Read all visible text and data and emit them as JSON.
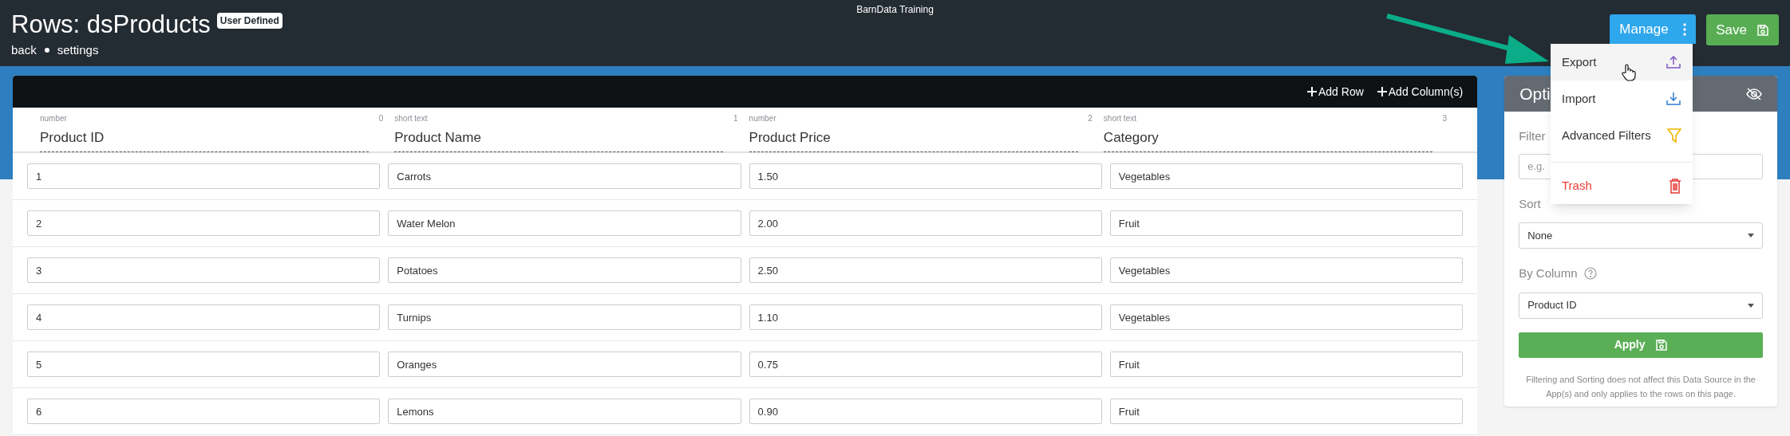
{
  "app_title": "BarnData Training",
  "page": {
    "title": "Rows: dsProducts",
    "badge": "User Defined",
    "links": [
      "back",
      "settings"
    ]
  },
  "actions": {
    "manage": "Manage",
    "save": "Save"
  },
  "manage_menu": [
    {
      "label": "Export",
      "kind": "export",
      "hovered": true
    },
    {
      "label": "Import",
      "kind": "import",
      "hovered": false
    },
    {
      "label": "Advanced Filters",
      "kind": "filter",
      "hovered": false
    },
    {
      "label": "Trash",
      "kind": "trash",
      "hovered": false
    }
  ],
  "table": {
    "toolbar": [
      "Add Row",
      "Add Column(s)"
    ],
    "columns": [
      {
        "type": "number",
        "index": "0",
        "name": "Product ID"
      },
      {
        "type": "short text",
        "index": "1",
        "name": "Product Name"
      },
      {
        "type": "number",
        "index": "2",
        "name": "Product Price"
      },
      {
        "type": "short text",
        "index": "3",
        "name": "Category"
      }
    ],
    "rows": [
      [
        "1",
        "Carrots",
        "1.50",
        "Vegetables"
      ],
      [
        "2",
        "Water Melon",
        "2.00",
        "Fruit"
      ],
      [
        "3",
        "Potatoes",
        "2.50",
        "Vegetables"
      ],
      [
        "4",
        "Turnips",
        "1.10",
        "Vegetables"
      ],
      [
        "5",
        "Oranges",
        "0.75",
        "Fruit"
      ],
      [
        "6",
        "Lemons",
        "0.90",
        "Fruit"
      ]
    ]
  },
  "options": {
    "title": "Opti",
    "filter_label": "Filter",
    "filter_placeholder": "e.g.",
    "sort_label": "Sort",
    "sort_value": "None",
    "by_column_label": "By Column",
    "by_column_value": "Product ID",
    "apply": "Apply",
    "note": "Filtering and Sorting does not affect this Data Source in the App(s) and only applies to the rows on this page."
  }
}
